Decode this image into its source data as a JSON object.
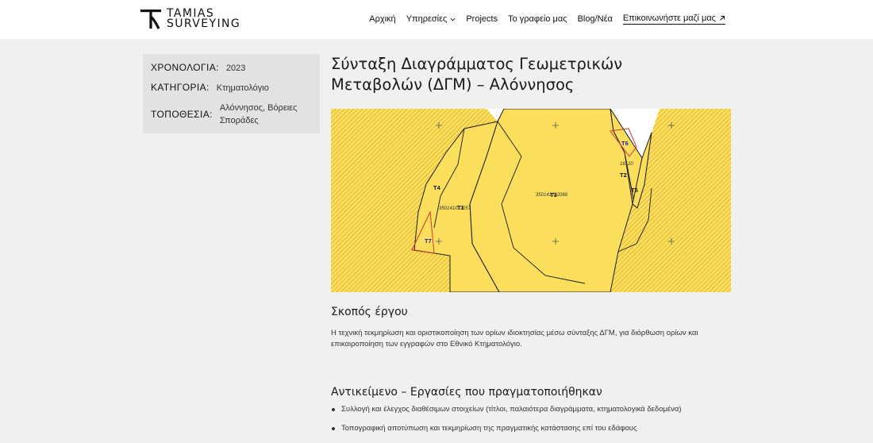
{
  "header": {
    "logo_line1": "TAMIAS",
    "logo_line2": "SURVEYING",
    "nav": {
      "home": "Αρχική",
      "services": "Υπηρεσίες",
      "projects": "Projects",
      "office": "Το γραφείο μας",
      "blog": "Blog/Νέα",
      "contact": "Επικοινωνήστε μαζί μας"
    }
  },
  "meta": {
    "year_label": "ΧΡΟΝΟΛΟΓΙΑ:",
    "year_value": "2023",
    "category_label": "ΚΑΤΗΓΟΡΙΑ:",
    "category_value": "Κτηματολόγιο",
    "location_label": "ΤΟΠΟΘΕΣΙΑ:",
    "location_line1": "Αλόννησος, Βόρειες",
    "location_line2": "Σποράδες"
  },
  "project": {
    "title_line1": "Σύνταξη Διαγράμματος Γεωμετρικών",
    "title_line2": "Μεταβολών (ΔΓΜ) – Αλόννησος"
  },
  "map": {
    "labels": {
      "t1": "Τ1",
      "t2": "Τ2",
      "t3": "Τ3",
      "t4": "Τ4",
      "t5": "Τ5",
      "t6": "Τ6",
      "t7": "Τ7",
      "kaek_left": "350141012057",
      "kaek_center": "350141012066",
      "kaek_right": "16120"
    },
    "colors": {
      "parcel_fill": "#fbde5c",
      "hatch_fill": "#e8bf2e",
      "edge": "#1a1a1a",
      "highlight": "#d33a2c",
      "label_blue": "#1c1c9a"
    }
  },
  "sections": {
    "purpose_heading": "Σκοπός έργου",
    "purpose_line1": "Η τεχνική τεκμηρίωση και οριστικοποίηση των ορίων ιδιοκτησίας μέσω σύνταξης ΔΓΜ, για διόρθωση ορίων και",
    "purpose_line2": "επικαιροποίηση των εγγραφών στο Εθνικό Κτηματολόγιο.",
    "scope_heading": "Αντικείμενο – Εργασίες που πραγματοποιήθηκαν",
    "scope_items": [
      "Συλλογή και έλεγχος διαθέσιμων στοιχείων (τίτλοι, παλαιότερα διαγράμματα, κτηματολογικά δεδομένα)",
      "Τοπογραφική αποτύπωση και τεκμηρίωση της πραγματικής κατάστασης επί του εδάφους"
    ]
  }
}
